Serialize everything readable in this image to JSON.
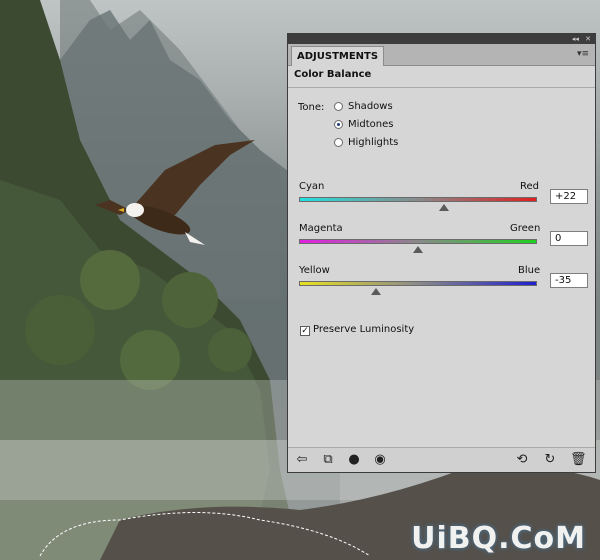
{
  "watermark": "UiBQ.CoM",
  "panel": {
    "tab_label": "ADJUSTMENTS",
    "title": "Color Balance",
    "tone": {
      "label": "Tone:",
      "options": [
        {
          "label": "Shadows",
          "selected": false
        },
        {
          "label": "Midtones",
          "selected": true
        },
        {
          "label": "Highlights",
          "selected": false
        }
      ]
    },
    "sliders": [
      {
        "left_label": "Cyan",
        "right_label": "Red",
        "value": "+22",
        "numeric": 22,
        "left_color": "#22e0e0",
        "right_color": "#e02020"
      },
      {
        "left_label": "Magenta",
        "right_label": "Green",
        "value": "0",
        "numeric": 0,
        "left_color": "#e020e0",
        "right_color": "#20d020"
      },
      {
        "left_label": "Yellow",
        "right_label": "Blue",
        "value": "-35",
        "numeric": -35,
        "left_color": "#e8e020",
        "right_color": "#2020d0"
      }
    ],
    "preserve_luminosity": {
      "label": "Preserve Luminosity",
      "checked": true
    }
  }
}
